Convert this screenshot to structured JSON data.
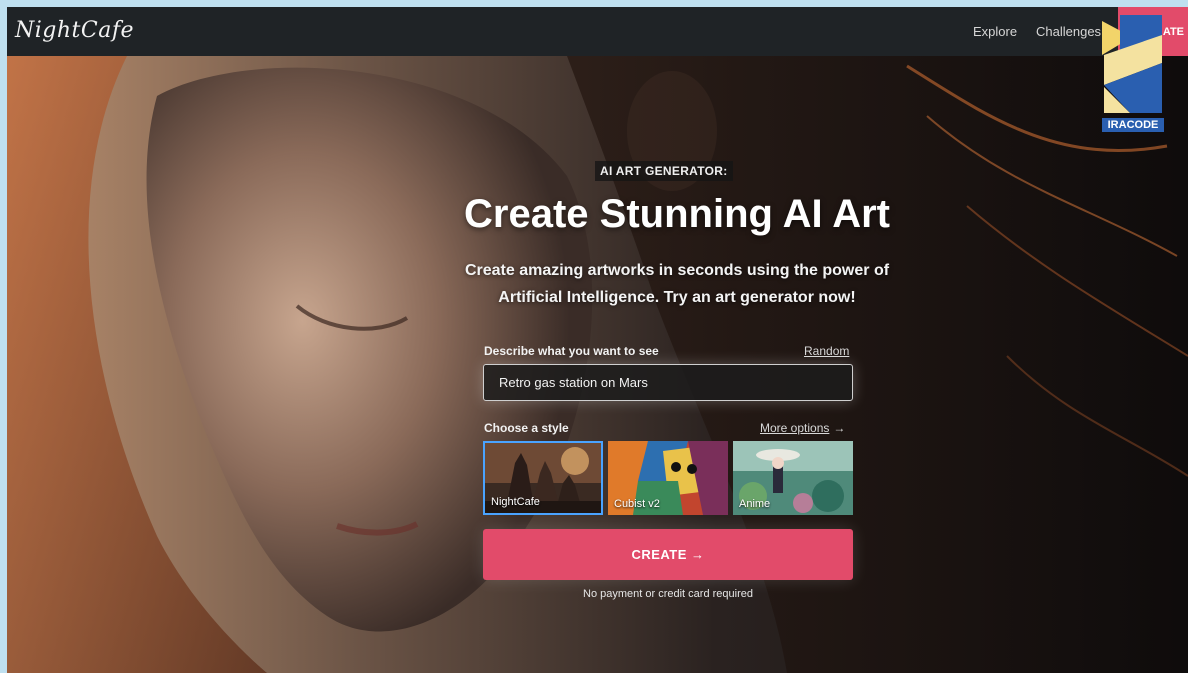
{
  "navbar": {
    "logo": "NightCafe",
    "links": [
      "Explore",
      "Challenges"
    ],
    "create_label": "ATE"
  },
  "watermark": {
    "text": "IRACODE"
  },
  "hero": {
    "eyebrow": "AI ART GENERATOR:",
    "title": "Create Stunning AI Art",
    "subtitle_line1": "Create amazing artworks in seconds using the power of",
    "subtitle_line2": "Artificial Intelligence. Try an art generator now!"
  },
  "form": {
    "describe_label": "Describe what you want to see",
    "random_label": "Random",
    "prompt_value": "Retro gas station on Mars",
    "style_label": "Choose a style",
    "more_options_label": "More options",
    "styles": [
      {
        "label": "NightCafe",
        "selected": true
      },
      {
        "label": "Cubist v2",
        "selected": false
      },
      {
        "label": "Anime",
        "selected": false
      }
    ],
    "create_label": "CREATE →",
    "note": "No payment or credit card required"
  },
  "colors": {
    "accent": "#e24b6a",
    "navbar": "#1f2326",
    "selected_border": "#4aa3ff"
  },
  "icons": {
    "more_options_arrow": "arrow-right-icon",
    "create_arrow": "arrow-right-icon"
  }
}
